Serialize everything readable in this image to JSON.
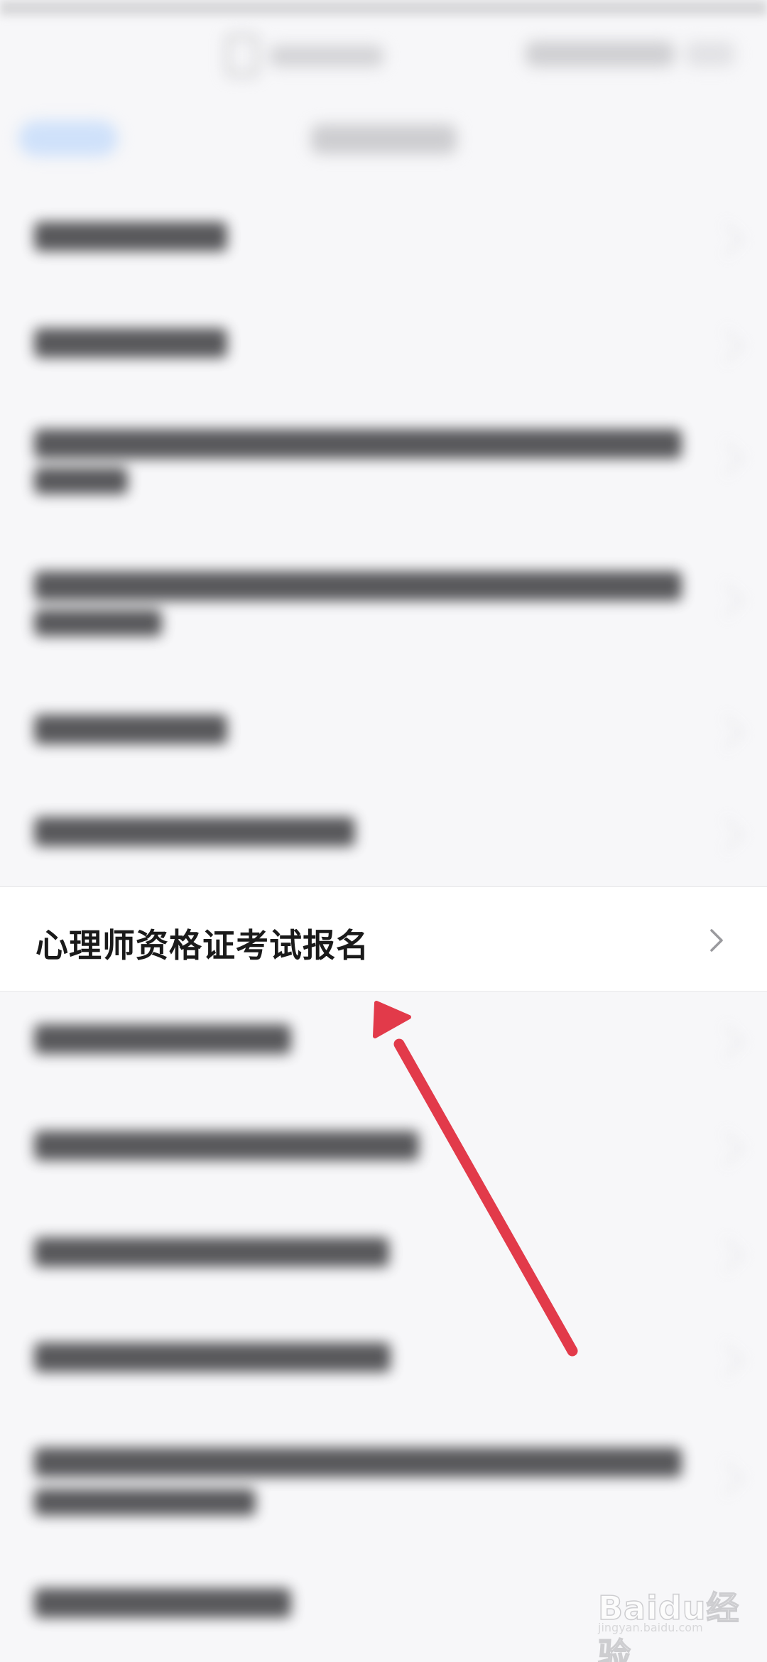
{
  "list": {
    "highlighted_item": {
      "label": "心理师资格证考试报名"
    }
  },
  "watermark": {
    "brand": "Baidu经验",
    "domain": "jingyan.baidu.com"
  },
  "colors": {
    "arrow": "#e23a4a",
    "background": "#f7f7f9",
    "highlight_background": "#ffffff",
    "text": "#1a1a1a",
    "chevron": "#9a9a9e"
  },
  "icons": {
    "row_chevron": "chevron-right-icon",
    "pointer": "arrow-pointer-icon"
  }
}
